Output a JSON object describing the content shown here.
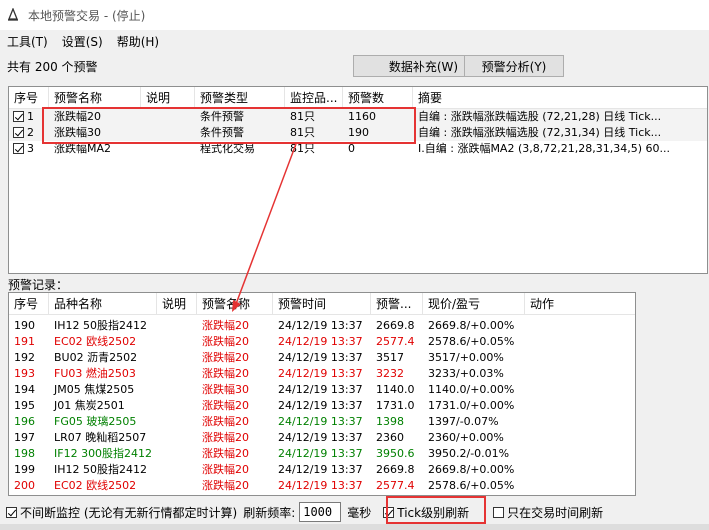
{
  "window": {
    "title": "本地预警交易  -  (停止)"
  },
  "menu": [
    "工具(T)",
    "设置(S)",
    "帮助(H)"
  ],
  "summary": "共有 200 个预警",
  "buttons": {
    "supplement": "数据补充(W)",
    "analysis": "预警分析(Y)"
  },
  "alerts": {
    "columns": [
      "序号",
      "预警名称",
      "说明",
      "预警类型",
      "监控品...",
      "预警数",
      "摘要"
    ],
    "rows": [
      {
        "checked": true,
        "idx": "1",
        "name": "涨跌幅20",
        "desc": "",
        "type": "条件预警",
        "monitor": "81只",
        "count": "1160",
        "summary": "自编 : 涨跌幅涨跌幅选股 (72,21,28) 日线 Tick..."
      },
      {
        "checked": true,
        "idx": "2",
        "name": "涨跌幅30",
        "desc": "",
        "type": "条件预警",
        "monitor": "81只",
        "count": "190",
        "summary": "自编 : 涨跌幅涨跌幅选股 (72,31,34) 日线 Tick..."
      },
      {
        "checked": true,
        "idx": "3",
        "name": "涨跌幅MA2",
        "desc": "",
        "type": "程式化交易",
        "monitor": "81只",
        "count": "0",
        "summary": "I.自编 : 涨跌幅MA2 (3,8,72,21,28,31,34,5) 60..."
      }
    ]
  },
  "records_label": "预警记录：",
  "records": {
    "columns": [
      "序号",
      "品种名称",
      "说明",
      "预警名称",
      "预警时间",
      "预警...",
      "现价/盈亏",
      "动作"
    ],
    "rows": [
      {
        "idx": "190",
        "product": "IH12 50股指2412",
        "desc": "",
        "alert": "涨跌幅20",
        "time": "24/12/19 13:37",
        "price": "2669.8",
        "pnl": "2669.8/+0.00%",
        "action": "",
        "color": "black"
      },
      {
        "idx": "191",
        "product": "EC02 欧线2502",
        "desc": "",
        "alert": "涨跌幅20",
        "time": "24/12/19 13:37",
        "price": "2577.4",
        "pnl": "2578.6/+0.05%",
        "action": "",
        "color": "red"
      },
      {
        "idx": "192",
        "product": "BU02 沥青2502",
        "desc": "",
        "alert": "涨跌幅20",
        "time": "24/12/19 13:37",
        "price": "3517",
        "pnl": "3517/+0.00%",
        "action": "",
        "color": "black"
      },
      {
        "idx": "193",
        "product": "FU03 燃油2503",
        "desc": "",
        "alert": "涨跌幅20",
        "time": "24/12/19 13:37",
        "price": "3232",
        "pnl": "3233/+0.03%",
        "action": "",
        "color": "red"
      },
      {
        "idx": "194",
        "product": "JM05 焦煤2505",
        "desc": "",
        "alert": "涨跌幅30",
        "time": "24/12/19 13:37",
        "price": "1140.0",
        "pnl": "1140.0/+0.00%",
        "action": "",
        "color": "black"
      },
      {
        "idx": "195",
        "product": "J01 焦炭2501",
        "desc": "",
        "alert": "涨跌幅20",
        "time": "24/12/19 13:37",
        "price": "1731.0",
        "pnl": "1731.0/+0.00%",
        "action": "",
        "color": "black"
      },
      {
        "idx": "196",
        "product": "FG05 玻璃2505",
        "desc": "",
        "alert": "涨跌幅20",
        "time": "24/12/19 13:37",
        "price": "1398",
        "pnl": "1397/-0.07%",
        "action": "",
        "color": "green"
      },
      {
        "idx": "197",
        "product": "LR07 晚籼稻2507",
        "desc": "",
        "alert": "涨跌幅20",
        "time": "24/12/19 13:37",
        "price": "2360",
        "pnl": "2360/+0.00%",
        "action": "",
        "color": "black"
      },
      {
        "idx": "198",
        "product": "IF12 300股指2412",
        "desc": "",
        "alert": "涨跌幅20",
        "time": "24/12/19 13:37",
        "price": "3950.6",
        "pnl": "3950.2/-0.01%",
        "action": "",
        "color": "green"
      },
      {
        "idx": "199",
        "product": "IH12 50股指2412",
        "desc": "",
        "alert": "涨跌幅20",
        "time": "24/12/19 13:37",
        "price": "2669.8",
        "pnl": "2669.8/+0.00%",
        "action": "",
        "color": "black"
      },
      {
        "idx": "200",
        "product": "EC02 欧线2502",
        "desc": "",
        "alert": "涨跌幅20",
        "time": "24/12/19 13:37",
        "price": "2577.4",
        "pnl": "2578.6/+0.05%",
        "action": "",
        "color": "red"
      }
    ]
  },
  "bottom": {
    "continuous_label": "不间断监控 (无论有无新行情都定时计算)",
    "continuous_checked": true,
    "freq_label": "刷新频率:",
    "freq_value": "1000",
    "freq_unit": "毫秒",
    "tick_label": "Tick级别刷新",
    "tick_checked": true,
    "trade_time_label": "只在交易时间刷新",
    "trade_time_checked": false
  },
  "colors": {
    "highlight": "#e53333",
    "red_text": "#e00000",
    "green_text": "#008000"
  }
}
